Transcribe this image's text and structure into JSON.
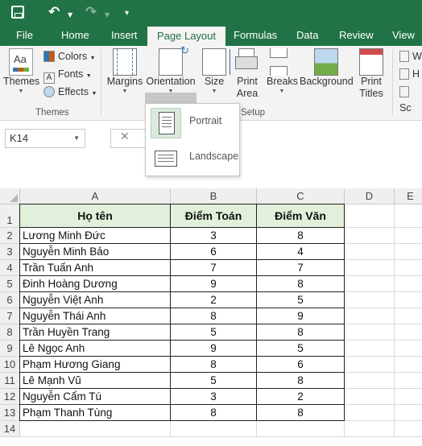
{
  "quick_access": {
    "save": "save-icon",
    "undo": "undo-icon",
    "redo": "redo-icon",
    "customize": "customize-icon"
  },
  "tabs": [
    "File",
    "Home",
    "Insert",
    "Page Layout",
    "Formulas",
    "Data",
    "Review",
    "View"
  ],
  "active_tab": "Page Layout",
  "ribbon": {
    "themes_label": "Themes",
    "colors_label": "Colors",
    "fonts_label": "Fonts",
    "effects_label": "Effects",
    "themes_group": "Themes",
    "margins_label": "Margins",
    "orientation_label": "Orientation",
    "size_label": "Size",
    "print_area_line1": "Print",
    "print_area_line2": "Area",
    "breaks_label": "Breaks",
    "background_label": "Background",
    "print_titles_line1": "Print",
    "print_titles_line2": "Titles",
    "page_setup_group_fragment": "Setup",
    "scale_w": "W",
    "scale_h": "H",
    "scale_s": "Sc"
  },
  "orientation_menu": {
    "items": [
      {
        "label": "Portrait",
        "selected": true
      },
      {
        "label": "Landscape",
        "selected": false
      }
    ]
  },
  "namebox": {
    "value": "K14"
  },
  "columns": [
    "A",
    "B",
    "C",
    "D",
    "E"
  ],
  "rows": [
    "1",
    "2",
    "3",
    "4",
    "5",
    "6",
    "7",
    "8",
    "9",
    "10",
    "11",
    "12",
    "13",
    "14"
  ],
  "table": {
    "headers": [
      "Họ tên",
      "Điểm Toán",
      "Điểm Văn"
    ],
    "data": [
      [
        "Lương Minh Đức",
        "3",
        "8"
      ],
      [
        "Nguyễn Minh Bảo",
        "6",
        "4"
      ],
      [
        "Trần Tuấn Anh",
        "7",
        "7"
      ],
      [
        "Đinh Hoàng Dương",
        "9",
        "8"
      ],
      [
        "Nguyễn Việt Anh",
        "2",
        "5"
      ],
      [
        "Nguyễn Thái Anh",
        "8",
        "9"
      ],
      [
        "Trần Huyền Trang",
        "5",
        "8"
      ],
      [
        "Lê Ngọc Anh",
        "9",
        "5"
      ],
      [
        "Phạm Hương Giang",
        "8",
        "6"
      ],
      [
        "Lê Mạnh Vũ",
        "5",
        "8"
      ],
      [
        "Nguyễn Cẩm Tú",
        "3",
        "2"
      ],
      [
        "Phạm Thanh Tùng",
        "8",
        "8"
      ]
    ]
  },
  "colors": {
    "excel_green": "#217346",
    "header_fill": "#e2efda",
    "ribbon_bg": "#f3f3f3"
  }
}
